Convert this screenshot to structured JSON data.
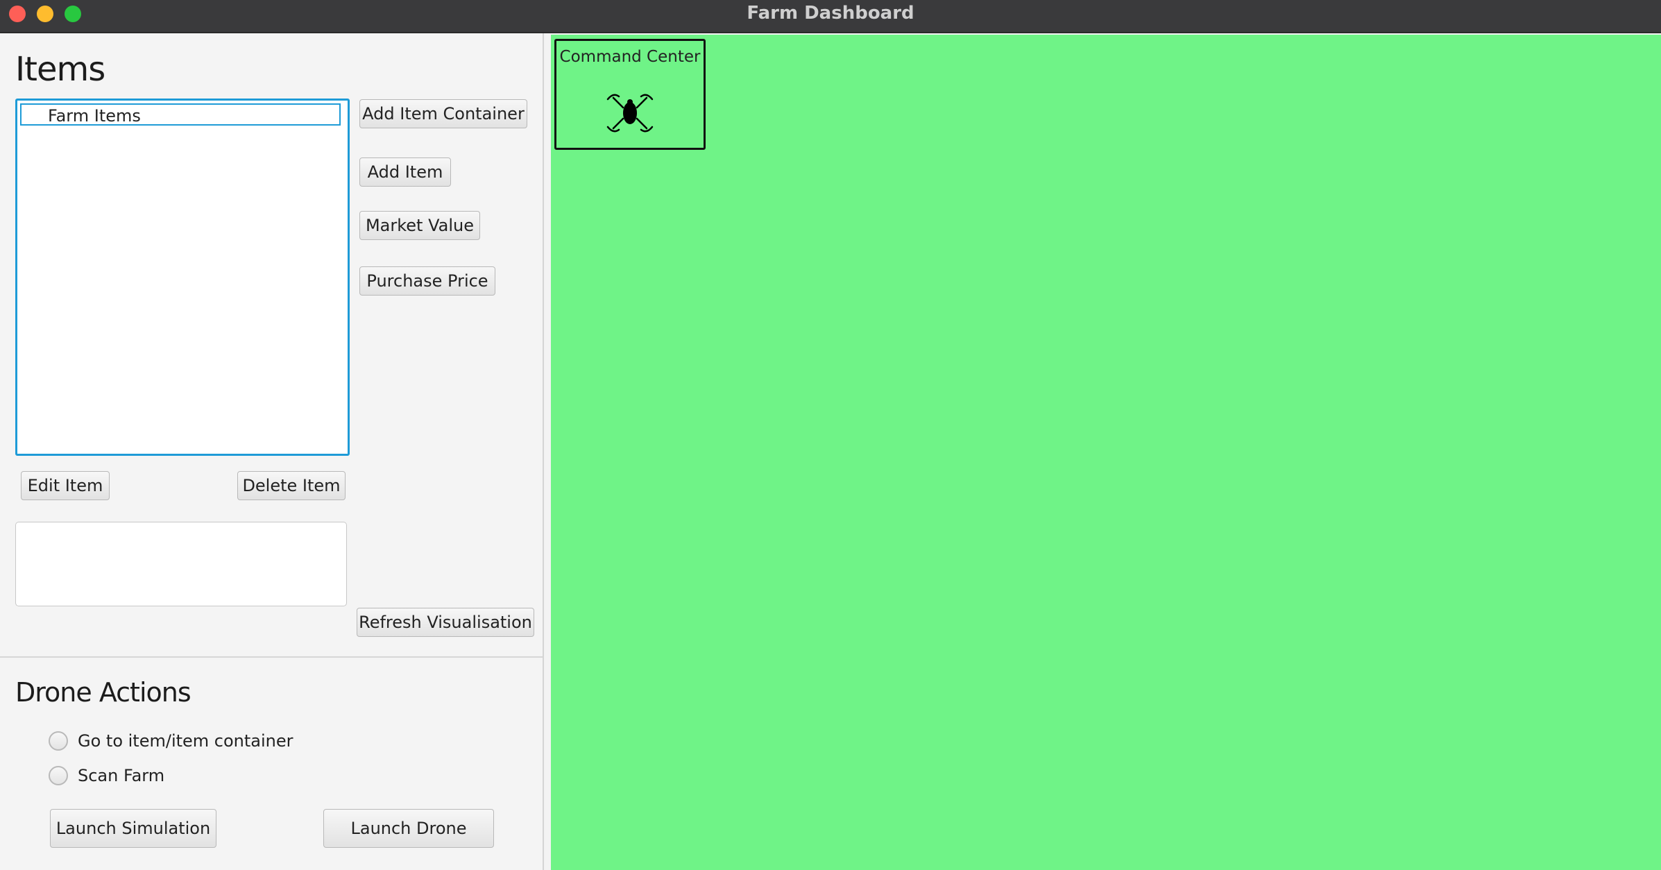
{
  "window": {
    "title": "Farm Dashboard"
  },
  "items_panel": {
    "title": "Items",
    "tree_root": "Farm Items",
    "buttons": {
      "add_item_container": "Add Item Container",
      "add_item": "Add Item",
      "market_value": "Market Value",
      "purchase_price": "Purchase Price",
      "edit_item": "Edit Item",
      "delete_item": "Delete Item",
      "refresh_visualisation": "Refresh Visualisation"
    }
  },
  "drone_panel": {
    "title": "Drone Actions",
    "options": [
      {
        "label": "Go to item/item container",
        "selected": false
      },
      {
        "label": "Scan Farm",
        "selected": false
      }
    ],
    "buttons": {
      "launch_simulation": "Launch Simulation",
      "launch_drone": "Launch Drone"
    }
  },
  "map": {
    "background_color": "#6ff387",
    "command_center_label": "Command Center",
    "command_center_icon": "drone-icon"
  }
}
